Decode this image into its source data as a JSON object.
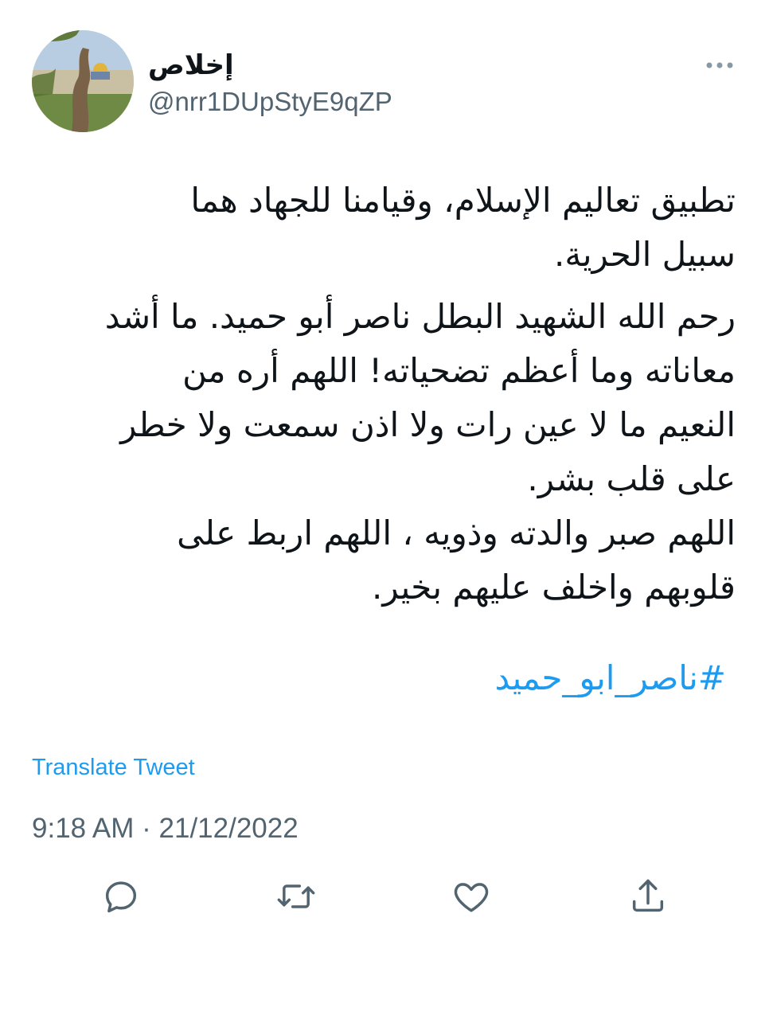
{
  "user": {
    "display_name": "إخلاص",
    "handle": "@nrr1DUpStyE9qZP"
  },
  "tweet": {
    "paragraphs": [
      "تطبيق تعاليم الإسلام، وقيامنا  للجهاد هما\nسبيل الحرية.",
      "رحم الله الشهيد البطل ناصر أبو حميد. ما أشد\nمعاناته وما أعظم تضحياته! اللهم أره من\nالنعيم ما لا عين رات ولا اذن سمعت ولا خطر\nعلى قلب بشر.\nاللهم صبر والدته وذويه ، اللهم اربط على\nقلوبهم واخلف عليهم بخير."
    ],
    "hashtag": "#ناصر_ابو_حميد"
  },
  "translate_label": "Translate Tweet",
  "timestamp": "9:18 AM · 21/12/2022",
  "icons": {
    "more": "more-dots-icon",
    "reply": "reply-icon",
    "retweet": "retweet-icon",
    "like": "heart-icon",
    "share": "share-icon"
  },
  "colors": {
    "link": "#1d9bf0",
    "secondary_text": "#536471",
    "primary_text": "#0f1419"
  }
}
